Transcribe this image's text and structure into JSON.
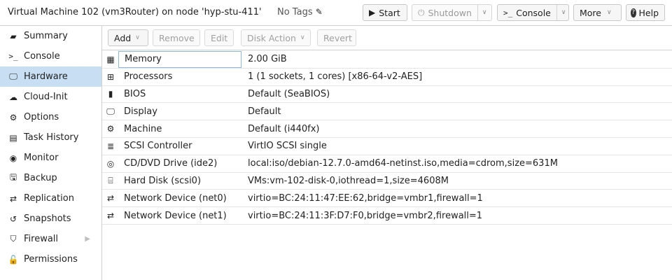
{
  "header": {
    "title": "Virtual Machine 102 (vm3Router) on node 'hyp-stu-411'",
    "tags_label": "No Tags",
    "buttons": {
      "start": "Start",
      "shutdown": "Shutdown",
      "console": "Console",
      "more": "More",
      "help": "Help"
    }
  },
  "sidebar": {
    "items": [
      {
        "label": "Summary",
        "icon": "book-icon"
      },
      {
        "label": "Console",
        "icon": "terminal-icon"
      },
      {
        "label": "Hardware",
        "icon": "monitor-icon"
      },
      {
        "label": "Cloud-Init",
        "icon": "cloud-icon"
      },
      {
        "label": "Options",
        "icon": "gear-icon"
      },
      {
        "label": "Task History",
        "icon": "list-icon"
      },
      {
        "label": "Monitor",
        "icon": "eye-icon"
      },
      {
        "label": "Backup",
        "icon": "floppy-icon"
      },
      {
        "label": "Replication",
        "icon": "retweet-icon"
      },
      {
        "label": "Snapshots",
        "icon": "history-icon"
      },
      {
        "label": "Firewall",
        "icon": "shield-icon"
      },
      {
        "label": "Permissions",
        "icon": "unlock-icon"
      }
    ],
    "active": "Hardware"
  },
  "toolbar": {
    "add": "Add",
    "remove": "Remove",
    "edit": "Edit",
    "disk_action": "Disk Action",
    "revert": "Revert"
  },
  "hardware": [
    {
      "name": "Memory",
      "value": "2.00 GiB",
      "icon": "memory-icon"
    },
    {
      "name": "Processors",
      "value": "1 (1 sockets, 1 cores) [x86-64-v2-AES]",
      "icon": "cpu-icon"
    },
    {
      "name": "BIOS",
      "value": "Default (SeaBIOS)",
      "icon": "microchip-icon"
    },
    {
      "name": "Display",
      "value": "Default",
      "icon": "desktop-icon"
    },
    {
      "name": "Machine",
      "value": "Default (i440fx)",
      "icon": "cogs-icon"
    },
    {
      "name": "SCSI Controller",
      "value": "VirtIO SCSI single",
      "icon": "database-icon"
    },
    {
      "name": "CD/DVD Drive (ide2)",
      "value": "local:iso/debian-12.7.0-amd64-netinst.iso,media=cdrom,size=631M",
      "icon": "cdrom-icon"
    },
    {
      "name": "Hard Disk (scsi0)",
      "value": "VMs:vm-102-disk-0,iothread=1,size=4608M",
      "icon": "harddisk-icon"
    },
    {
      "name": "Network Device (net0)",
      "value": "virtio=BC:24:11:47:EE:62,bridge=vmbr1,firewall=1",
      "icon": "exchange-icon"
    },
    {
      "name": "Network Device (net1)",
      "value": "virtio=BC:24:11:3F:D7:F0,bridge=vmbr2,firewall=1",
      "icon": "exchange-icon"
    }
  ]
}
